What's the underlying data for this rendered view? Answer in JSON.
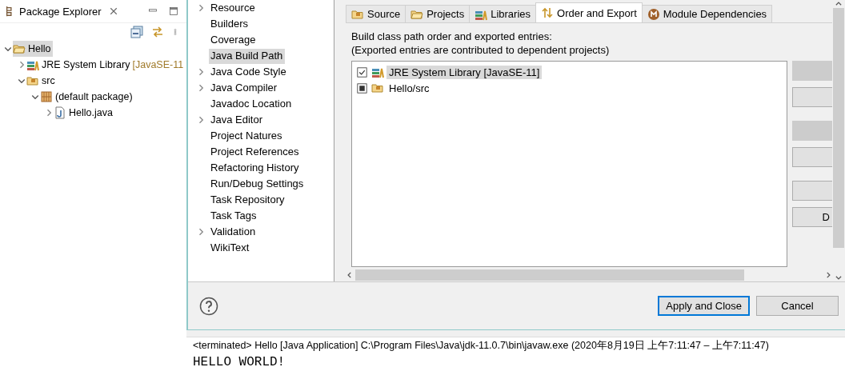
{
  "explorer": {
    "title": "Package Explorer",
    "tree": [
      {
        "label": "Hello",
        "kind": "project",
        "selected": true,
        "expanded": true,
        "children": [
          {
            "label": "JRE System Library",
            "decoration": "[JavaSE-11",
            "kind": "library",
            "selected": false,
            "expanded": false
          },
          {
            "label": "src",
            "kind": "folder",
            "selected": false,
            "expanded": true,
            "children": [
              {
                "label": "(default package)",
                "kind": "package",
                "selected": false,
                "expanded": true,
                "children": [
                  {
                    "label": "Hello.java",
                    "kind": "java",
                    "selected": false,
                    "expanded": false
                  }
                ]
              }
            ]
          }
        ]
      }
    ]
  },
  "properties": {
    "items": [
      {
        "label": "Resource",
        "expandable": true,
        "selected": false
      },
      {
        "label": "Builders",
        "expandable": false,
        "selected": false
      },
      {
        "label": "Coverage",
        "expandable": false,
        "selected": false
      },
      {
        "label": "Java Build Path",
        "expandable": false,
        "selected": true
      },
      {
        "label": "Java Code Style",
        "expandable": true,
        "selected": false
      },
      {
        "label": "Java Compiler",
        "expandable": true,
        "selected": false
      },
      {
        "label": "Javadoc Location",
        "expandable": false,
        "selected": false
      },
      {
        "label": "Java Editor",
        "expandable": true,
        "selected": false
      },
      {
        "label": "Project Natures",
        "expandable": false,
        "selected": false
      },
      {
        "label": "Project References",
        "expandable": false,
        "selected": false
      },
      {
        "label": "Refactoring History",
        "expandable": false,
        "selected": false
      },
      {
        "label": "Run/Debug Settings",
        "expandable": false,
        "selected": false
      },
      {
        "label": "Task Repository",
        "expandable": false,
        "selected": false
      },
      {
        "label": "Task Tags",
        "expandable": false,
        "selected": false
      },
      {
        "label": "Validation",
        "expandable": true,
        "selected": false
      },
      {
        "label": "WikiText",
        "expandable": false,
        "selected": false
      }
    ]
  },
  "tabs": [
    {
      "label": "Source",
      "kind": "folder",
      "selected": false
    },
    {
      "label": "Projects",
      "kind": "project",
      "selected": false
    },
    {
      "label": "Libraries",
      "kind": "library",
      "selected": false
    },
    {
      "label": "Order and Export",
      "kind": "order",
      "selected": true
    },
    {
      "label": "Module Dependencies",
      "kind": "module",
      "selected": false
    }
  ],
  "description": [
    "Build class path order and exported entries:",
    "(Exported entries are contributed to dependent projects)"
  ],
  "entries": [
    {
      "label": "JRE System Library [JavaSE-11]",
      "kind": "library",
      "checked": true,
      "grayed": false,
      "selected": true
    },
    {
      "label": "Hello/src",
      "kind": "folder",
      "checked": true,
      "grayed": true,
      "selected": false
    }
  ],
  "side_buttons": [
    {
      "disabled": true
    },
    {
      "disabled": false
    },
    {
      "disabled": true
    },
    {
      "disabled": false
    },
    {
      "disabled": false
    },
    {
      "disabled": false,
      "label": "D"
    }
  ],
  "footer_buttons": [
    {
      "label": "Apply and Close",
      "default": true
    },
    {
      "label": "Cancel",
      "default": false
    }
  ],
  "console": {
    "header": "<terminated> Hello [Java Application] C:\\Program Files\\Java\\jdk-11.0.7\\bin\\javaw.exe  (2020年8月19日 上午7:11:47 – 上午7:11:47)",
    "output": "HELLO WORLD!"
  }
}
